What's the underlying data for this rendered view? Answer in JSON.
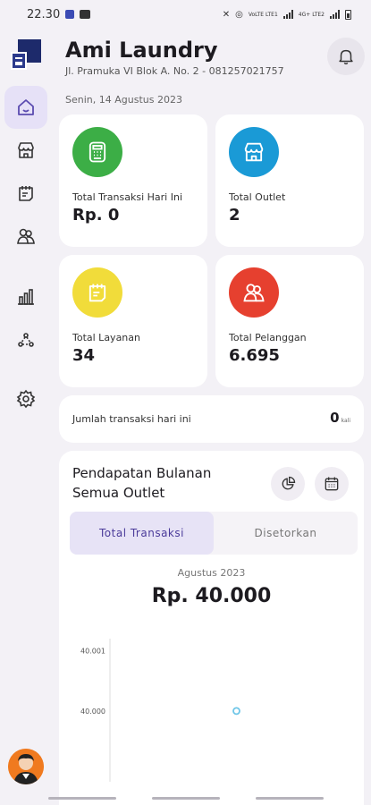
{
  "status_bar": {
    "time": "22.30",
    "net1": "VoLTE LTE1",
    "net2": "4G+ LTE2"
  },
  "header": {
    "title": "Ami Laundry",
    "address": "Jl. Pramuka VI Blok A. No. 2 - 081257021757",
    "date": "Senin, 14 Agustus 2023"
  },
  "stats": [
    {
      "label": "Total Transaksi Hari Ini",
      "value": "Rp. 0",
      "icon": "cash-register-icon",
      "color": "#3cae46"
    },
    {
      "label": "Total Outlet",
      "value": "2",
      "icon": "store-icon",
      "color": "#1a9ad6"
    },
    {
      "label": "Total Layanan",
      "value": "34",
      "icon": "services-list-icon",
      "color": "#f1dc3a"
    },
    {
      "label": "Total Pelanggan",
      "value": "6.695",
      "icon": "customers-icon",
      "color": "#e6402f"
    }
  ],
  "transactions_today": {
    "label": "Jumlah transaksi hari ini",
    "value": "0",
    "unit": "kali"
  },
  "revenue": {
    "title": "Pendapatan Bulanan Semua Outlet",
    "tabs": [
      "Total Transaksi",
      "Disetorkan"
    ],
    "active_tab": 0,
    "period": "Agustus 2023",
    "amount": "Rp. 40.000"
  },
  "chart_data": {
    "type": "scatter",
    "x": [
      "Agustus 2023"
    ],
    "y": [
      40000
    ],
    "ytick_labels": [
      "40.001",
      "40.000"
    ],
    "yticks": [
      40001,
      40000
    ],
    "ylim": [
      39998.9,
      40001.2
    ],
    "color": "#6ec6e8"
  },
  "colors": {
    "accent": "#e6e1f7",
    "accent_text": "#4b3b9a",
    "background": "#f3f1f6"
  }
}
